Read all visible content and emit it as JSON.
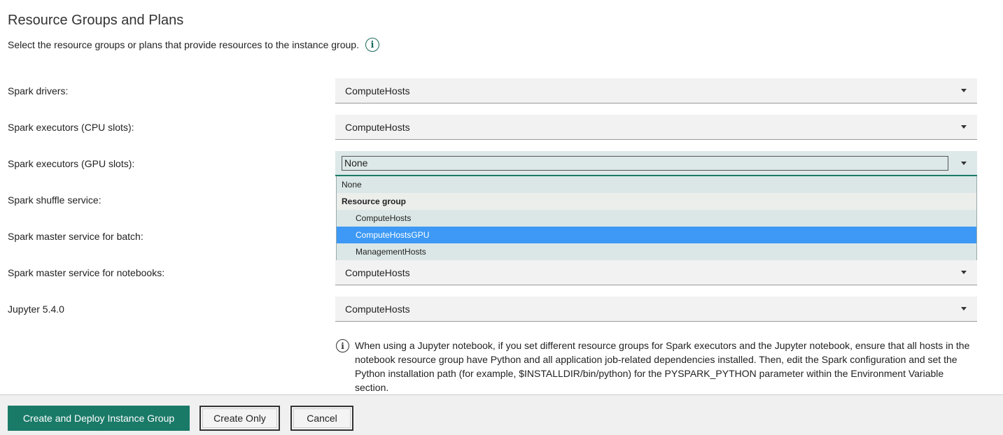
{
  "header": {
    "title": "Resource Groups and Plans",
    "subtitle": "Select the resource groups or plans that provide resources to the instance group.",
    "info_glyph": "i"
  },
  "rows": [
    {
      "label": "Spark drivers:",
      "value": "ComputeHosts"
    },
    {
      "label": "Spark executors (CPU slots):",
      "value": "ComputeHosts"
    },
    {
      "label": "Spark executors (GPU slots):",
      "value": "None"
    },
    {
      "label": "Spark shuffle service:",
      "value": ""
    },
    {
      "label": "Spark master service for batch:",
      "value": ""
    },
    {
      "label": "Spark master service for notebooks:",
      "value": "ComputeHosts"
    },
    {
      "label": "Jupyter 5.4.0",
      "value": "ComputeHosts"
    }
  ],
  "dropdown": {
    "none_option": "None",
    "group_label": "Resource group",
    "options": [
      "ComputeHosts",
      "ComputeHostsGPU",
      "ManagementHosts"
    ],
    "highlighted": "ComputeHostsGPU"
  },
  "note": {
    "text": "When using a Jupyter notebook, if you set different resource groups for Spark executors and the Jupyter notebook, ensure that all hosts in the notebook resource group have Python and all application job-related dependencies installed. Then, edit the Spark configuration and set the Python installation path (for example, $INSTALLDIR/bin/python) for the PYSPARK_PYTHON parameter within the Environment Variable section."
  },
  "footer": {
    "deploy_label": "Create and Deploy Instance Group",
    "create_only_label": "Create Only",
    "cancel_label": "Cancel"
  },
  "colors": {
    "accent": "#1a7a68",
    "highlight": "#3d99f5"
  },
  "icons": {
    "info": "info-icon",
    "caret": "chevron-down-icon"
  }
}
